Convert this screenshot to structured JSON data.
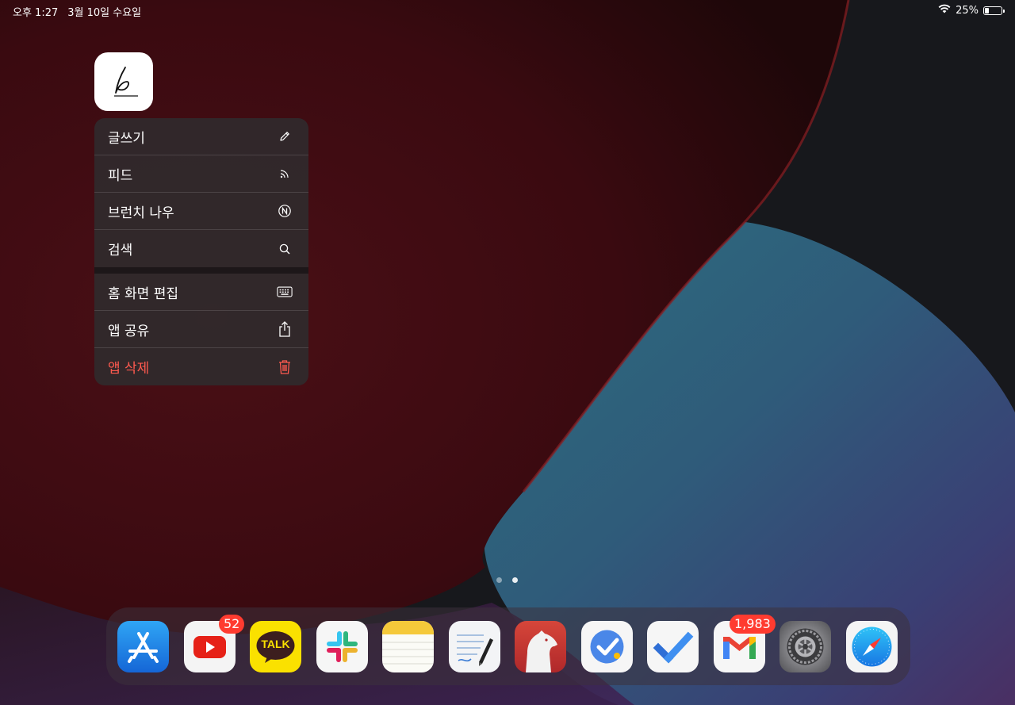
{
  "status_bar": {
    "time": "오후 1:27",
    "date": "3월 10일 수요일",
    "battery_percent": "25%",
    "battery_level": 0.25,
    "wifi_icon": "wifi-icon"
  },
  "focused_app": {
    "icon": "handwriting-pen-icon"
  },
  "context_menu": {
    "group1": [
      {
        "label": "글쓰기",
        "icon": "pencil-icon"
      },
      {
        "label": "피드",
        "icon": "rss-icon"
      },
      {
        "label": "브런치 나우",
        "icon": "n-circle-icon"
      },
      {
        "label": "검색",
        "icon": "search-icon"
      }
    ],
    "group2": [
      {
        "label": "홈 화면 편집",
        "icon": "keyboard-icon"
      },
      {
        "label": "앱 공유",
        "icon": "share-icon"
      },
      {
        "label": "앱 삭제",
        "icon": "trash-icon",
        "color": "#ff5a4f"
      }
    ]
  },
  "page_dots": {
    "count": 2,
    "active_index": 1
  },
  "dock": {
    "apps": [
      {
        "name": "app-store-icon"
      },
      {
        "name": "youtube-icon",
        "badge": "52"
      },
      {
        "name": "kakaotalk-icon",
        "label": "TALK"
      },
      {
        "name": "slack-icon"
      },
      {
        "name": "notes-icon"
      },
      {
        "name": "notes-pen-icon"
      },
      {
        "name": "bear-icon"
      },
      {
        "name": "google-tasks-icon"
      },
      {
        "name": "microsoft-todo-icon"
      },
      {
        "name": "gmail-icon",
        "badge": "1,983"
      },
      {
        "name": "settings-icon"
      },
      {
        "name": "safari-icon"
      }
    ]
  },
  "colors": {
    "destructive": "#ff5a4f",
    "badge": "#ff3b30"
  }
}
